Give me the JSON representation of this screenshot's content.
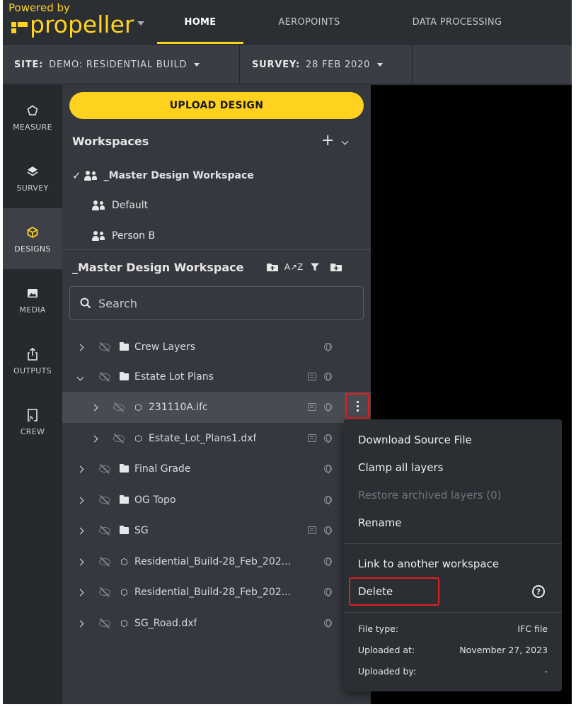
{
  "brand": {
    "powered_by": "Powered by",
    "name": "propeller"
  },
  "nav": {
    "tabs": [
      {
        "label": "HOME",
        "active": true
      },
      {
        "label": "AEROPOINTS",
        "active": false
      },
      {
        "label": "DATA PROCESSING",
        "active": false
      }
    ]
  },
  "sitebar": {
    "site_label": "SITE:",
    "site_value": "DEMO: RESIDENTIAL BUILD",
    "survey_label": "SURVEY:",
    "survey_value": "28 FEB 2020"
  },
  "rail": [
    {
      "label": "MEASURE",
      "icon": "measure-icon",
      "active": false
    },
    {
      "label": "SURVEY",
      "icon": "layers-icon",
      "active": false
    },
    {
      "label": "DESIGNS",
      "icon": "cube-icon",
      "active": true
    },
    {
      "label": "MEDIA",
      "icon": "image-icon",
      "active": false
    },
    {
      "label": "OUTPUTS",
      "icon": "share-icon",
      "active": false
    },
    {
      "label": "CREW",
      "icon": "device-icon",
      "active": false
    }
  ],
  "panel": {
    "upload_label": "UPLOAD DESIGN",
    "workspaces_title": "Workspaces",
    "add_symbol": "+",
    "workspaces": [
      {
        "name": "_Master Design Workspace",
        "checked": true
      },
      {
        "name": "Default",
        "checked": false
      },
      {
        "name": "Person B",
        "checked": false
      }
    ],
    "current_workspace": "_Master Design Workspace",
    "search_placeholder": "Search"
  },
  "layers": [
    {
      "name": "Crew Layers",
      "kind": "folder",
      "indent": 0,
      "expanded": false
    },
    {
      "name": "Estate Lot Plans",
      "kind": "folder",
      "indent": 0,
      "expanded": true
    },
    {
      "name": "231110A.ifc",
      "kind": "file",
      "indent": 1,
      "expanded": false,
      "selected": true
    },
    {
      "name": "Estate_Lot_Plans1.dxf",
      "kind": "file",
      "indent": 1,
      "expanded": false
    },
    {
      "name": "Final Grade",
      "kind": "folder",
      "indent": 0,
      "expanded": false
    },
    {
      "name": "OG Topo",
      "kind": "folder",
      "indent": 0,
      "expanded": false
    },
    {
      "name": "SG",
      "kind": "folder",
      "indent": 0,
      "expanded": false
    },
    {
      "name": "Residential_Build-28_Feb_202...",
      "kind": "file",
      "indent": 0,
      "expanded": false
    },
    {
      "name": "Residential_Build-28_Feb_202...",
      "kind": "file",
      "indent": 0,
      "expanded": false
    },
    {
      "name": "SG_Road.dxf",
      "kind": "file",
      "indent": 0,
      "expanded": false
    }
  ],
  "context_menu": {
    "items": [
      {
        "label": "Download Source File",
        "disabled": false
      },
      {
        "label": "Clamp all layers",
        "disabled": false
      },
      {
        "label": "Restore archived layers (0)",
        "disabled": true
      },
      {
        "label": "Rename",
        "disabled": false
      },
      {
        "label": "Link to another workspace",
        "disabled": false
      },
      {
        "label": "Delete",
        "disabled": false
      }
    ],
    "help_symbol": "?",
    "meta": [
      {
        "label": "File type:",
        "value": "IFC file"
      },
      {
        "label": "Uploaded at:",
        "value": "November 27, 2023"
      },
      {
        "label": "Uploaded by:",
        "value": "-"
      }
    ]
  },
  "colors": {
    "accent": "#ffd21f",
    "highlight": "#e02020",
    "panel": "#35383e",
    "rail": "#262a2e"
  }
}
